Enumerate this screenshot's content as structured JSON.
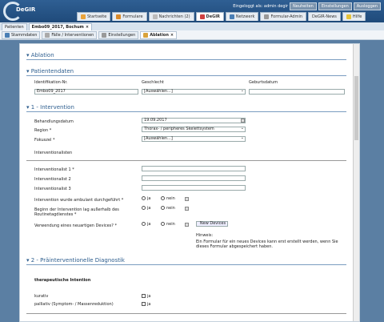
{
  "app": {
    "logo": "DeGIR",
    "user_text": "Eingeloggt als: admin degir",
    "btn_new": "Neuheiten",
    "btn_settings": "Einstellungen",
    "btn_logout": "Ausloggen"
  },
  "main_tabs": [
    "Startseite",
    "Formulare",
    "Nachrichten (2)",
    "DeGIR",
    "Netzwerk",
    "Formular-Admin",
    "DeGIR-News",
    "Hilfe"
  ],
  "tabs2": [
    "Patienten",
    "Embo09_2017, Bochum"
  ],
  "tabs3": [
    "Stammdaten",
    "Fälle / Interventionen",
    "Einstellungen",
    "Ablation"
  ],
  "form": {
    "title": "Ablation",
    "sec_patient": "Patientendaten",
    "lbl_id": "Identifikation-Nr.",
    "val_id": "Embo09_2017",
    "lbl_sex": "Geschlecht",
    "val_sex": "[Auswählen...]",
    "lbl_birth": "Geburtsdatum",
    "sec_intervention": "1 - Intervention",
    "lbl_date": "Behandlungsdatum",
    "val_date": "19.09.2017",
    "lbl_region": "Region *",
    "val_region": "Thorax- / peripheres Skelettsystem",
    "lbl_focus": "Fokuszel *",
    "val_focus": "[Auswählen...]",
    "sub_interventionalists": "Interventionalisten",
    "lbl_i1": "Interventionalist 1 *",
    "lbl_i2": "Interventionalist 2",
    "lbl_i3": "Interventionalist 3",
    "lbl_ambulant": "Intervention wurde ambulant durchgeführt *",
    "lbl_begin": "Beginn der Intervention lag außerhalb des Routinetagdienstes *",
    "lbl_device": "Verwendung eines neuartigen Devices? *",
    "opt_yes": "ja",
    "opt_no": "nein",
    "btn_new_devices": "New Devices",
    "hint_title": "Hinweis:",
    "hint_text": "Ein Formular für ein neues Devices kann erst erstellt werden, wenn Sie dieses Formular abgespeichert haben.",
    "sec_diag": "2 - Präinterventionelle Diagnostik",
    "sub_therapy": "therapeutische Intention",
    "lbl_curative": "kurativ",
    "lbl_palliative": "palliativ (Symptom- / Massenreduktion)"
  }
}
